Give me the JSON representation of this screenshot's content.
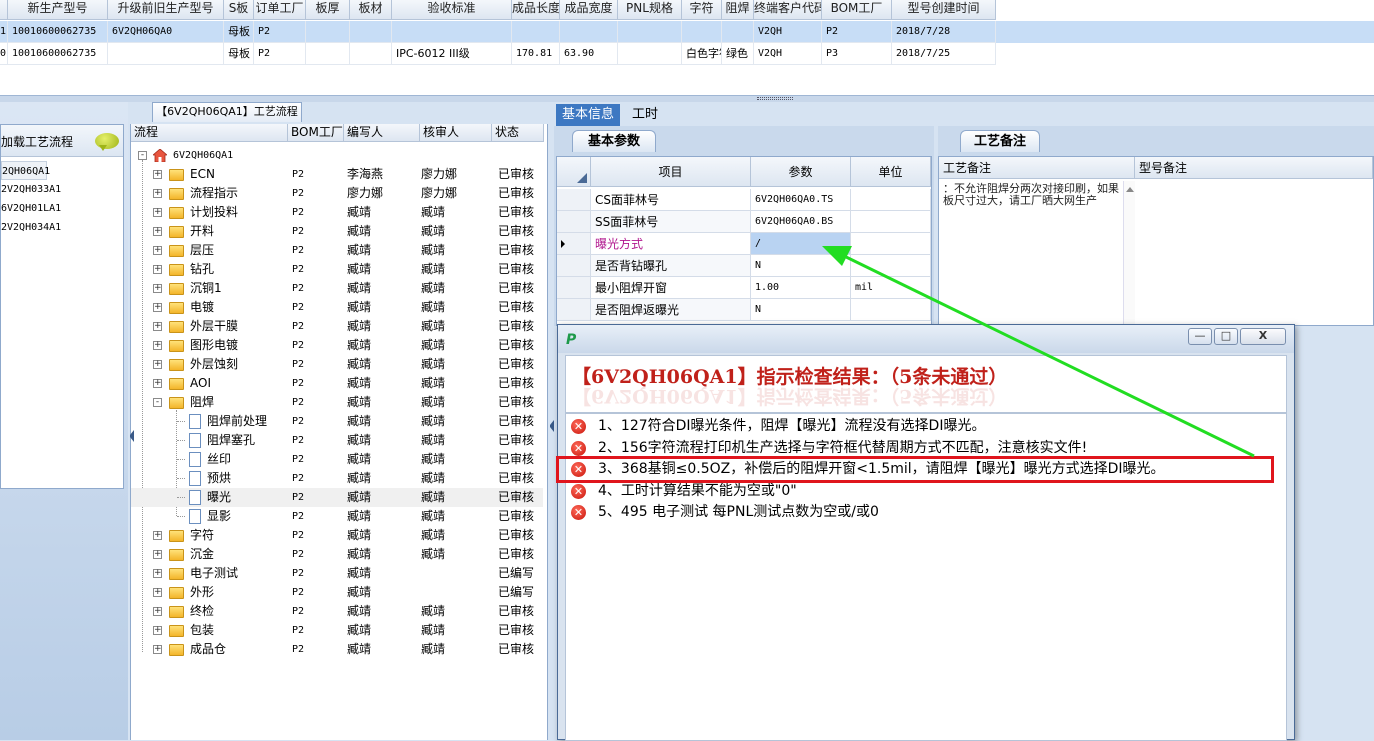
{
  "top_grid": {
    "columns": [
      "新生产型号",
      "升级前旧生产型号",
      "S板",
      "订单工厂",
      "板厚",
      "板材",
      "验收标准",
      "成品长度",
      "成品宽度",
      "PNL规格",
      "字符",
      "阻焊",
      "终端客户代码",
      "BOM工厂",
      "型号创建时间"
    ],
    "rows": [
      {
        "lead": "1",
        "new_model": "10010600062735",
        "old_model": "6V2QH06QA0",
        "s_board": "母板",
        "factory": "P2",
        "thickness": "",
        "material": "",
        "standard": "",
        "length": "",
        "width": "",
        "pnl": "",
        "char": "",
        "mask": "",
        "customer": "V2QH",
        "bom": "P2",
        "created": "2018/7/28",
        "selected": true
      },
      {
        "lead": "0",
        "new_model": "10010600062735",
        "old_model": "",
        "s_board": "母板",
        "factory": "P2",
        "thickness": "",
        "material": "",
        "standard": "IPC-6012 III级",
        "length": "170.81",
        "width": "63.90",
        "pnl": "",
        "char": "白色字符",
        "mask": "绿色",
        "customer": "V2QH",
        "bom": "P3",
        "created": "2018/7/25",
        "selected": false
      }
    ]
  },
  "left_panel": {
    "load_title": "加载工艺流程",
    "items": [
      "2QH06QA1",
      "2V2QH033A1",
      "6V2QH01LA1",
      "2V2QH034A1"
    ]
  },
  "tree_panel": {
    "tab_label": "【6V2QH06QA1】工艺流程",
    "headers": [
      "流程",
      "BOM工厂",
      "编写人",
      "核审人",
      "状态"
    ],
    "root": "6V2QH06QA1",
    "rows": [
      {
        "name": "ECN",
        "factory": "P2",
        "writer": "李海燕",
        "reviewer": "廖力娜",
        "status": "已审核",
        "level": 1,
        "type": "folder",
        "exp": "+"
      },
      {
        "name": "流程指示",
        "factory": "P2",
        "writer": "廖力娜",
        "reviewer": "廖力娜",
        "status": "已审核",
        "level": 1,
        "type": "folder",
        "exp": "+"
      },
      {
        "name": "计划投料",
        "factory": "P2",
        "writer": "臧靖",
        "reviewer": "臧靖",
        "status": "已审核",
        "level": 1,
        "type": "folder",
        "exp": "+"
      },
      {
        "name": "开料",
        "factory": "P2",
        "writer": "臧靖",
        "reviewer": "臧靖",
        "status": "已审核",
        "level": 1,
        "type": "folder",
        "exp": "+"
      },
      {
        "name": "层压",
        "factory": "P2",
        "writer": "臧靖",
        "reviewer": "臧靖",
        "status": "已审核",
        "level": 1,
        "type": "folder",
        "exp": "+"
      },
      {
        "name": "钻孔",
        "factory": "P2",
        "writer": "臧靖",
        "reviewer": "臧靖",
        "status": "已审核",
        "level": 1,
        "type": "folder",
        "exp": "+"
      },
      {
        "name": "沉铜1",
        "factory": "P2",
        "writer": "臧靖",
        "reviewer": "臧靖",
        "status": "已审核",
        "level": 1,
        "type": "folder",
        "exp": "+"
      },
      {
        "name": "电镀",
        "factory": "P2",
        "writer": "臧靖",
        "reviewer": "臧靖",
        "status": "已审核",
        "level": 1,
        "type": "folder",
        "exp": "+"
      },
      {
        "name": "外层干膜",
        "factory": "P2",
        "writer": "臧靖",
        "reviewer": "臧靖",
        "status": "已审核",
        "level": 1,
        "type": "folder",
        "exp": "+"
      },
      {
        "name": "图形电镀",
        "factory": "P2",
        "writer": "臧靖",
        "reviewer": "臧靖",
        "status": "已审核",
        "level": 1,
        "type": "folder",
        "exp": "+"
      },
      {
        "name": "外层蚀刻",
        "factory": "P2",
        "writer": "臧靖",
        "reviewer": "臧靖",
        "status": "已审核",
        "level": 1,
        "type": "folder",
        "exp": "+"
      },
      {
        "name": "AOI",
        "factory": "P2",
        "writer": "臧靖",
        "reviewer": "臧靖",
        "status": "已审核",
        "level": 1,
        "type": "folder",
        "exp": "+"
      },
      {
        "name": "阻焊",
        "factory": "P2",
        "writer": "臧靖",
        "reviewer": "臧靖",
        "status": "已审核",
        "level": 1,
        "type": "folder",
        "exp": "-"
      },
      {
        "name": "阻焊前处理",
        "factory": "P2",
        "writer": "臧靖",
        "reviewer": "臧靖",
        "status": "已审核",
        "level": 2,
        "type": "doc",
        "exp": ""
      },
      {
        "name": "阻焊塞孔",
        "factory": "P2",
        "writer": "臧靖",
        "reviewer": "臧靖",
        "status": "已审核",
        "level": 2,
        "type": "doc",
        "exp": ""
      },
      {
        "name": "丝印",
        "factory": "P2",
        "writer": "臧靖",
        "reviewer": "臧靖",
        "status": "已审核",
        "level": 2,
        "type": "doc",
        "exp": ""
      },
      {
        "name": "预烘",
        "factory": "P2",
        "writer": "臧靖",
        "reviewer": "臧靖",
        "status": "已审核",
        "level": 2,
        "type": "doc",
        "exp": ""
      },
      {
        "name": "曝光",
        "factory": "P2",
        "writer": "臧靖",
        "reviewer": "臧靖",
        "status": "已审核",
        "level": 2,
        "type": "doc",
        "exp": "",
        "selected": true
      },
      {
        "name": "显影",
        "factory": "P2",
        "writer": "臧靖",
        "reviewer": "臧靖",
        "status": "已审核",
        "level": 2,
        "type": "doc",
        "exp": ""
      },
      {
        "name": "字符",
        "factory": "P2",
        "writer": "臧靖",
        "reviewer": "臧靖",
        "status": "已审核",
        "level": 1,
        "type": "folder",
        "exp": "+"
      },
      {
        "name": "沉金",
        "factory": "P2",
        "writer": "臧靖",
        "reviewer": "臧靖",
        "status": "已审核",
        "level": 1,
        "type": "folder",
        "exp": "+"
      },
      {
        "name": "电子测试",
        "factory": "P2",
        "writer": "臧靖",
        "reviewer": "",
        "status": "已编写",
        "level": 1,
        "type": "folder",
        "exp": "+"
      },
      {
        "name": "外形",
        "factory": "P2",
        "writer": "臧靖",
        "reviewer": "",
        "status": "已编写",
        "level": 1,
        "type": "folder",
        "exp": "+"
      },
      {
        "name": "终检",
        "factory": "P2",
        "writer": "臧靖",
        "reviewer": "臧靖",
        "status": "已审核",
        "level": 1,
        "type": "folder",
        "exp": "+"
      },
      {
        "name": "包装",
        "factory": "P2",
        "writer": "臧靖",
        "reviewer": "臧靖",
        "status": "已审核",
        "level": 1,
        "type": "folder",
        "exp": "+"
      },
      {
        "name": "成品仓",
        "factory": "P2",
        "writer": "臧靖",
        "reviewer": "臧靖",
        "status": "已审核",
        "level": 1,
        "type": "folder",
        "exp": "+"
      }
    ]
  },
  "right_panel": {
    "tabs": [
      "基本信息",
      "工时"
    ],
    "subtab_params": "基本参数",
    "subtab_notes": "工艺备注",
    "param_headers": [
      "项目",
      "参数",
      "单位"
    ],
    "params": [
      {
        "item": "CS面菲林号",
        "value": "6V2QH06QA0.TS",
        "unit": ""
      },
      {
        "item": "SS面菲林号",
        "value": "6V2QH06QA0.BS",
        "unit": ""
      },
      {
        "item": "曝光方式",
        "value": "/",
        "unit": "",
        "current": true
      },
      {
        "item": "是否背钻曝孔",
        "value": "N",
        "unit": ""
      },
      {
        "item": "最小阻焊开窗",
        "value": "1.00",
        "unit": "mil"
      },
      {
        "item": "是否阻焊返曝光",
        "value": "N",
        "unit": ""
      }
    ],
    "notes_headers": [
      "工艺备注",
      "型号备注"
    ],
    "process_note": "：不允许阻焊分两次对接印刷，如果板尺寸过大，请工厂晒大网生产"
  },
  "dialog": {
    "minimize": "—",
    "maximize": "□",
    "close": "X",
    "heading": "【6V2QH06QA1】指示检查结果：（5条未通过）",
    "messages": [
      "1、127符合DI曝光条件，阻焊【曝光】流程没有选择DI曝光。",
      "2、156字符流程打印机生产选择与字符框代替周期方式不匹配，注意核实文件!",
      "3、368基铜≤0.5OZ，补偿后的阻焊开窗<1.5mil，请阻焊【曝光】曝光方式选择DI曝光。",
      "4、工时计算结果不能为空或\"0\"",
      "5、495 电子测试 每PNL测试点数为空或/或0"
    ]
  },
  "colors": {
    "selected_row": "#c7ddf6",
    "dialog_title_text": "#c0211a",
    "highlight_box": "#e0151d",
    "arrow": "#22dd22"
  }
}
